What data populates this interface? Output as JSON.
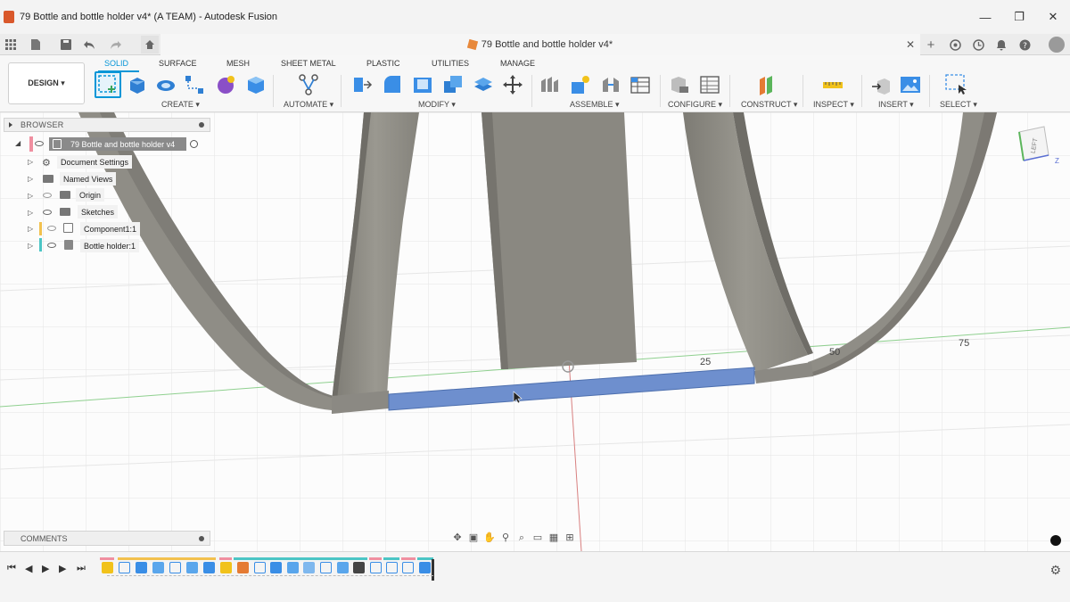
{
  "window": {
    "title": "79 Bottle and bottle holder v4* (A TEAM) - Autodesk Fusion",
    "minimize": "—",
    "restore": "❐",
    "close": "✕"
  },
  "tabs": {
    "document_title": "79 Bottle and bottle holder v4*",
    "close": "✕",
    "new_tab": "+"
  },
  "toolbar": {
    "workspace_button": "DESIGN ▾",
    "workspace_tabs": [
      "SOLID",
      "SURFACE",
      "MESH",
      "SHEET METAL",
      "PLASTIC",
      "UTILITIES",
      "MANAGE"
    ],
    "groups": [
      "CREATE ▾",
      "AUTOMATE ▾",
      "MODIFY ▾",
      "ASSEMBLE ▾",
      "CONFIGURE ▾",
      "CONSTRUCT ▾",
      "INSPECT ▾",
      "INSERT ▾",
      "SELECT ▾"
    ]
  },
  "browser": {
    "header": "BROWSER",
    "root": "79 Bottle and bottle holder v4",
    "items": [
      "Document Settings",
      "Named Views",
      "Origin",
      "Sketches",
      "Component1:1",
      "Bottle holder:1"
    ]
  },
  "comments": {
    "header": "COMMENTS"
  },
  "viewcube": {
    "face": "LEFT",
    "axis_z": "Z"
  },
  "dimensions": [
    "25",
    "50",
    "75"
  ],
  "colors": {
    "accent": "#0696d7",
    "body": "#8f8d86",
    "body_dark": "#6f6d67",
    "selection": "#6e8fce",
    "grid": "#e4e4e4",
    "axis_green": "#8fd08f",
    "axis_red": "#d88080"
  }
}
